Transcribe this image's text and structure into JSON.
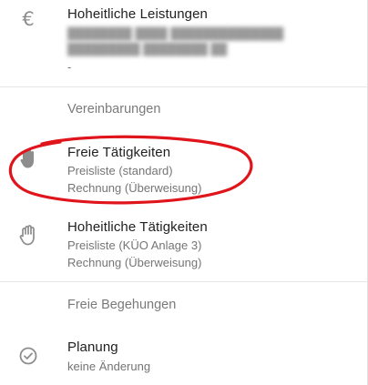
{
  "items": [
    {
      "title": "Hoheitliche Leistungen",
      "detail_placeholder": "-",
      "icon": "euro-icon"
    },
    {
      "title": "Freie Tätigkeiten",
      "line1": "Preisliste (standard)",
      "line2": "Rechnung (Überweisung)",
      "icon": "hand-icon"
    },
    {
      "title": "Hoheitliche Tätigkeiten",
      "line1": "Preisliste (KÜO Anlage 3)",
      "line2": "Rechnung (Überweisung)",
      "icon": "hand-icon"
    },
    {
      "title": "Planung",
      "line1": "keine Änderung",
      "icon": "check-circle-icon"
    }
  ],
  "sections": {
    "agreements": "Vereinbarungen",
    "free_inspections": "Freie Begehungen"
  },
  "colors": {
    "annotation": "#e0151c",
    "icon": "#8a8a8a",
    "divider": "#e6e6e6"
  }
}
